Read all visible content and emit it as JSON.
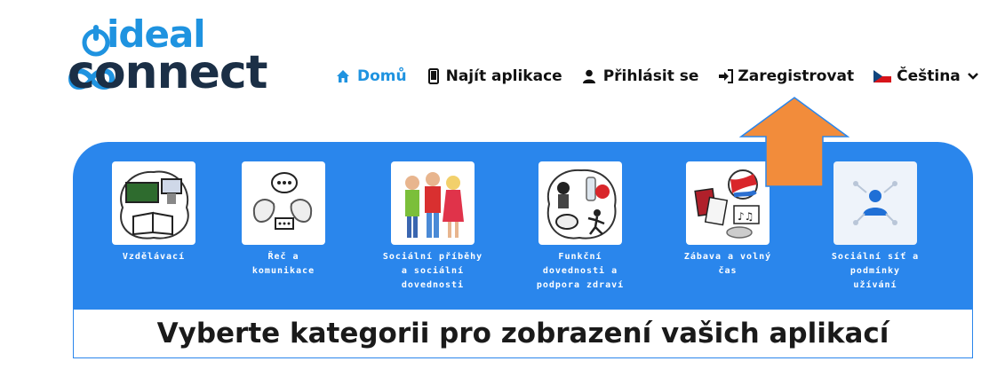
{
  "logo": {
    "line1": "ideal",
    "line2": "connect"
  },
  "nav": {
    "home": "Domů",
    "find_apps": "Najít aplikace",
    "login": "Přihlásit se",
    "register": "Zaregistrovat",
    "language": "Čeština"
  },
  "categories": [
    {
      "lines": [
        "Vzdělávací"
      ],
      "icon": "education-icon"
    },
    {
      "lines": [
        "Řeč a",
        "komunikace"
      ],
      "icon": "speech-icon"
    },
    {
      "lines": [
        "Sociální příběhy",
        "a sociální",
        "dovednosti"
      ],
      "icon": "people-icon"
    },
    {
      "lines": [
        "Funkční",
        "dovednosti a",
        "podpora zdraví"
      ],
      "icon": "health-icon"
    },
    {
      "lines": [
        "Zábava a volný",
        "čas"
      ],
      "icon": "leisure-icon"
    },
    {
      "lines": [
        "Sociální síť a",
        "podmínky",
        "užívání"
      ],
      "icon": "network-icon"
    }
  ],
  "cta": "Vyberte kategorii pro zobrazení vašich aplikací",
  "colors": {
    "primary_blue": "#2a86ec",
    "logo_blue": "#1f93e0",
    "logo_dark": "#1b2f46",
    "arrow": "#f28c3b"
  }
}
